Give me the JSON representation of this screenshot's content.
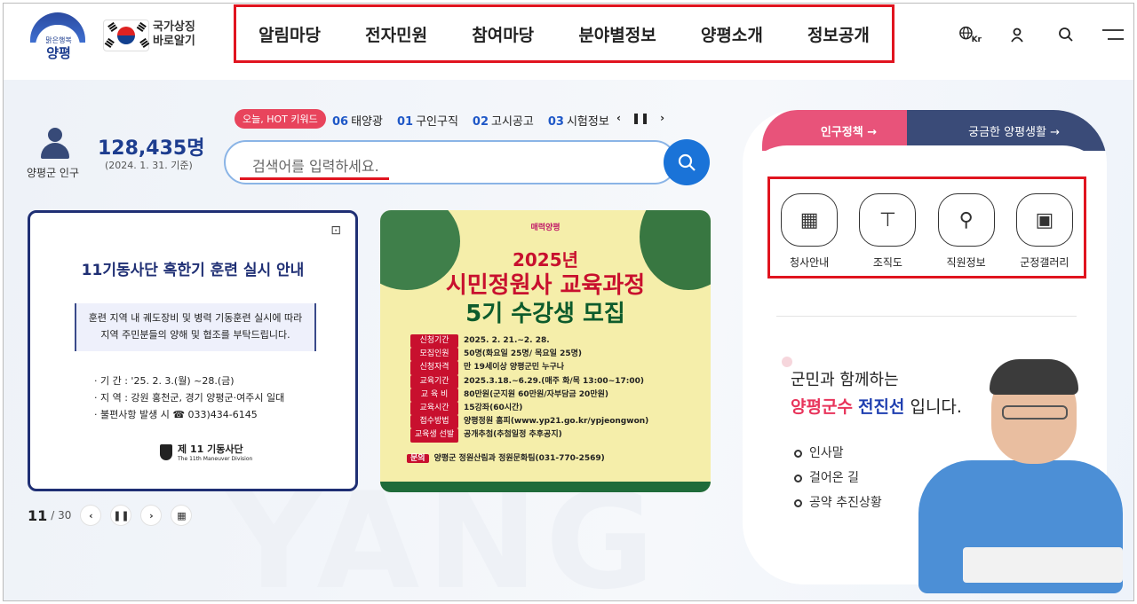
{
  "header": {
    "logo_sub": "맑은행복",
    "logo_name": "양평",
    "national_symbol": [
      "국가상징",
      "바로알기"
    ],
    "gnb": [
      "알림마당",
      "전자민원",
      "참여마당",
      "분야별정보",
      "양평소개",
      "정보공개"
    ],
    "utils": {
      "lang": "Kr"
    }
  },
  "population": {
    "label": "양평군 인구",
    "count": "128,435명",
    "date": "(2024. 1. 31. 기준)"
  },
  "hot": {
    "badge": "오늘, HOT 키워드",
    "items": [
      {
        "num": "06",
        "text": "태양광"
      },
      {
        "num": "01",
        "text": "구인구직"
      },
      {
        "num": "02",
        "text": "고시공고"
      },
      {
        "num": "03",
        "text": "시험정보"
      }
    ]
  },
  "search": {
    "placeholder": "검색어를 입력하세요."
  },
  "card1": {
    "title": "11기동사단 혹한기 훈련 실시 안내",
    "box_line1": "훈련 지역 내 궤도장비 및 병력 기동훈련 실시에 따라",
    "box_line2": "지역 주민분들의 양해 및 협조를 부탁드립니다.",
    "info1": "· 기 간 : '25. 2. 3.(월) ~28.(금)",
    "info2": "· 지 역 : 강원 홍천군, 경기 양평군·여주시 일대",
    "info3": "· 불편사항 발생 시 ☎ 033)434-6145",
    "org": "제 11 기동사단",
    "org_en": "The 11th Maneuver Division"
  },
  "card2": {
    "tag": "매력양평",
    "year": "2025년",
    "title1": "시민정원사 교육과정",
    "title2": "5기 수강생 모집",
    "rows": [
      {
        "k": "신청기간",
        "v": "2025. 2. 21.~2. 28."
      },
      {
        "k": "모집인원",
        "v": "50명(화요일 25명/ 목요일 25명)"
      },
      {
        "k": "신청자격",
        "v": "만 19세이상 양평군민 누구나"
      },
      {
        "k": "교육기간",
        "v": "2025.3.18.~6.29.(매주 화/목 13:00~17:00)"
      },
      {
        "k": "교 육 비",
        "v": "80만원(군지원 60만원/자부담금 20만원)"
      },
      {
        "k": "교육시간",
        "v": "15강좌(60시간)"
      },
      {
        "k": "접수방법",
        "v": "양평정원 홈피(www.yp21.go.kr/ypjeongwon)"
      },
      {
        "k": "교육생 선발",
        "v": "공개추첨(추첨일정 추후공지)"
      }
    ],
    "inq_label": "문의",
    "inq": "양평군 정원산림과 정원문화팀(031-770-2569)"
  },
  "pager": {
    "current": "11",
    "total": "/ 30"
  },
  "right": {
    "tab1": "인구정책 →",
    "tab2": "궁금한 양평생활 →",
    "quick": [
      {
        "label": "청사안내",
        "icon": "building-icon",
        "glyph": "▦"
      },
      {
        "label": "조직도",
        "icon": "org-chart-icon",
        "glyph": "⊤"
      },
      {
        "label": "직원정보",
        "icon": "staff-search-icon",
        "glyph": "⚲"
      },
      {
        "label": "군정갤러리",
        "icon": "gallery-icon",
        "glyph": "▣"
      }
    ],
    "greet1": "군민과 함께하는",
    "greet_a": "양평군수",
    "greet_b": "전진선",
    "greet_c": " 입니다.",
    "links": [
      "인사말",
      "걸어온 길",
      "공약 추진상황"
    ]
  },
  "colors": {
    "accent_red": "#e0141f",
    "brand_blue": "#1d3d8f",
    "pink": "#e8537a",
    "navy": "#3a4b78"
  }
}
